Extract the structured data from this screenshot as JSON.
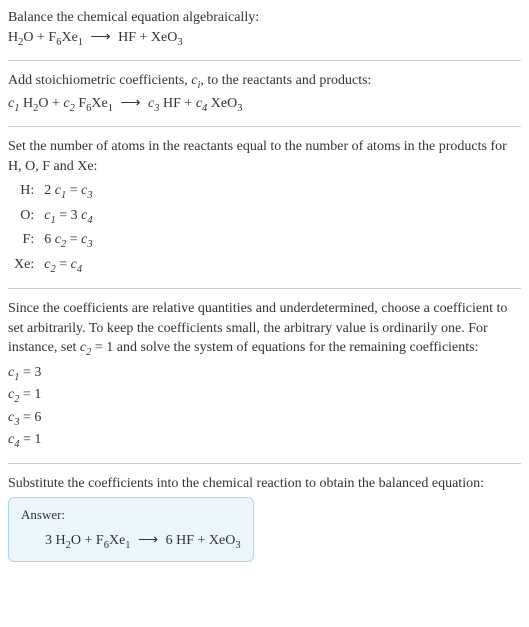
{
  "section1": {
    "line1_pre": "Balance the chemical equation algebraically:",
    "eq_h2o": "H",
    "eq_h2o_sub": "2",
    "eq_o": "O",
    "plus": " + ",
    "eq_f": "F",
    "eq_f_sub": "6",
    "eq_xe": "Xe",
    "eq_xe_sub": "1",
    "arrow": "⟶",
    "eq_hf": "HF",
    "eq_xeo": "XeO",
    "eq_xeo_sub": "3"
  },
  "section2": {
    "line1_a": "Add stoichiometric coefficients, ",
    "line1_c": "c",
    "line1_i": "i",
    "line1_b": ", to the reactants and products:",
    "c1": "c",
    "c1_sub": "1",
    "sp": " ",
    "c2": "c",
    "c2_sub": "2",
    "c3": "c",
    "c3_sub": "3",
    "c4": "c",
    "c4_sub": "4"
  },
  "section3": {
    "line1": "Set the number of atoms in the reactants equal to the number of atoms in the products for H, O, F and Xe:",
    "rows": {
      "h_label": "H:",
      "h_eq_a": "2 ",
      "h_eq_c1": "c",
      "h_eq_c1s": "1",
      "h_eq_eq": " = ",
      "h_eq_c3": "c",
      "h_eq_c3s": "3",
      "o_label": "O:",
      "o_eq_c1": "c",
      "o_eq_c1s": "1",
      "o_eq_eq": " = 3 ",
      "o_eq_c4": "c",
      "o_eq_c4s": "4",
      "f_label": "F:",
      "f_eq_a": "6 ",
      "f_eq_c2": "c",
      "f_eq_c2s": "2",
      "f_eq_eq": " = ",
      "f_eq_c3": "c",
      "f_eq_c3s": "3",
      "xe_label": "Xe:",
      "xe_eq_c2": "c",
      "xe_eq_c2s": "2",
      "xe_eq_eq": " = ",
      "xe_eq_c4": "c",
      "xe_eq_c4s": "4"
    }
  },
  "section4": {
    "para_a": "Since the coefficients are relative quantities and underdetermined, choose a coefficient to set arbitrarily. To keep the coefficients small, the arbitrary value is ordinarily one. For instance, set ",
    "para_c2": "c",
    "para_c2s": "2",
    "para_b": " = 1 and solve the system of equations for the remaining coefficients:",
    "sol": {
      "c1": "c",
      "c1s": "1",
      "c1v": " = 3",
      "c2": "c",
      "c2s": "2",
      "c2v": " = 1",
      "c3": "c",
      "c3s": "3",
      "c3v": " = 6",
      "c4": "c",
      "c4s": "4",
      "c4v": " = 1"
    }
  },
  "section5": {
    "line1": "Substitute the coefficients into the chemical reaction to obtain the balanced equation:",
    "answer_label": "Answer:",
    "eq_3": "3 ",
    "eq_6": "6 "
  },
  "chart_data": {
    "type": "table",
    "title": "Atom balance equations",
    "rows": [
      {
        "element": "H",
        "equation": "2 c1 = c3"
      },
      {
        "element": "O",
        "equation": "c1 = 3 c4"
      },
      {
        "element": "F",
        "equation": "6 c2 = c3"
      },
      {
        "element": "Xe",
        "equation": "c2 = c4"
      }
    ],
    "solution": {
      "c1": 3,
      "c2": 1,
      "c3": 6,
      "c4": 1
    },
    "unbalanced": "H2O + F6Xe1 ⟶ HF + XeO3",
    "balanced": "3 H2O + F6Xe1 ⟶ 6 HF + XeO3"
  }
}
